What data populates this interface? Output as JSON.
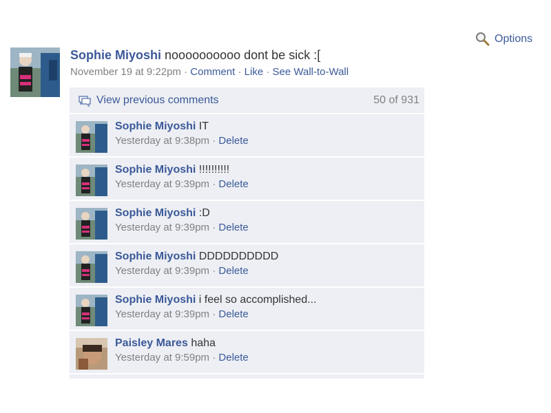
{
  "options": {
    "label": "Options",
    "icon": "search-icon"
  },
  "post": {
    "author": "Sophie Miyoshi",
    "text": "noooooooooo dont be sick :[",
    "timestamp": "November 19 at 9:22pm",
    "separator": "·",
    "actions": {
      "comment": "Comment",
      "like": "Like",
      "wall": "See Wall-to-Wall"
    }
  },
  "comments_panel": {
    "view_previous": "View previous comments",
    "count": "50 of 931",
    "items": [
      {
        "author": "Sophie Miyoshi",
        "text": "IT",
        "timestamp": "Yesterday at 9:38pm",
        "delete": "Delete"
      },
      {
        "author": "Sophie Miyoshi",
        "text": "!!!!!!!!!!",
        "timestamp": "Yesterday at 9:39pm",
        "delete": "Delete"
      },
      {
        "author": "Sophie Miyoshi",
        "text": ":D",
        "timestamp": "Yesterday at 9:39pm",
        "delete": "Delete"
      },
      {
        "author": "Sophie Miyoshi",
        "text": "DDDDDDDDDD",
        "timestamp": "Yesterday at 9:39pm",
        "delete": "Delete"
      },
      {
        "author": "Sophie Miyoshi",
        "text": "i feel so accomplished...",
        "timestamp": "Yesterday at 9:39pm",
        "delete": "Delete"
      },
      {
        "author": "Paisley Mares",
        "text": "haha",
        "timestamp": "Yesterday at 9:59pm",
        "delete": "Delete"
      }
    ]
  },
  "colors": {
    "link": "#3b5998",
    "meta": "#808080",
    "panel_bg": "#edeff4"
  }
}
